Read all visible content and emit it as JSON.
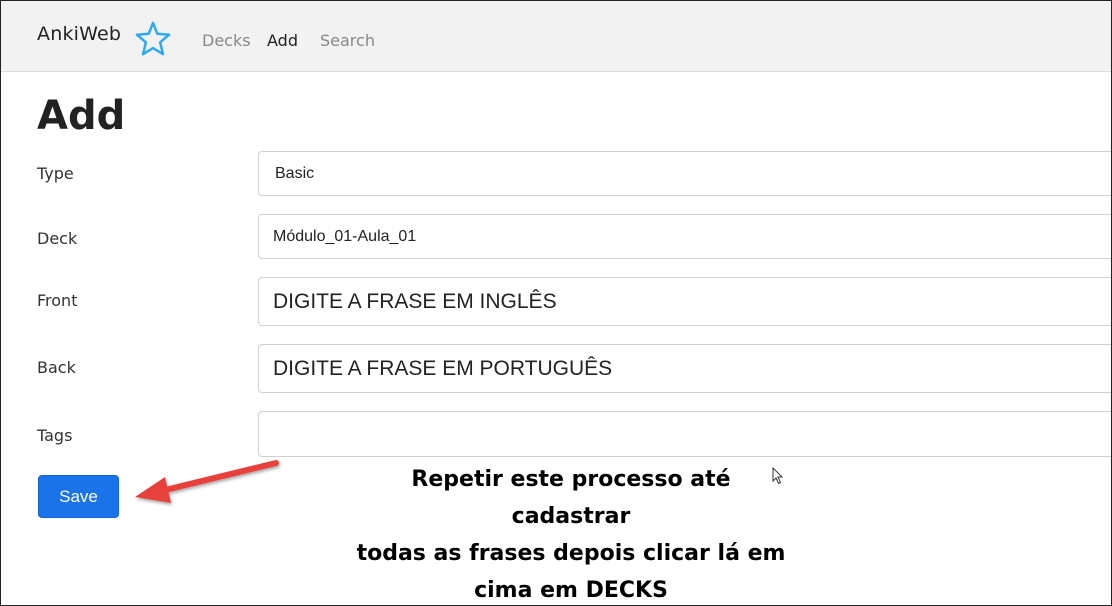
{
  "app": {
    "brand": "AnkiWeb",
    "brand_icon": "star-icon",
    "accent_color": "#1a73e8"
  },
  "nav": {
    "decks": "Decks",
    "add": "Add",
    "search": "Search",
    "active": "Add"
  },
  "page": {
    "title": "Add"
  },
  "form": {
    "type_label": "Type",
    "type_value": "Basic",
    "deck_label": "Deck",
    "deck_value": "Módulo_01-Aula_01",
    "front_label": "Front",
    "front_value": "DIGITE A FRASE EM INGLÊS",
    "back_label": "Back",
    "back_value": "DIGITE A FRASE EM PORTUGUÊS",
    "tags_label": "Tags",
    "tags_value": "",
    "save_label": "Save"
  },
  "annotation": {
    "lines": [
      "Repetir este processo até cadastrar",
      "todas as frases depois clicar lá em",
      "cima em DECKS"
    ],
    "arrow_color": "#e8403a"
  }
}
